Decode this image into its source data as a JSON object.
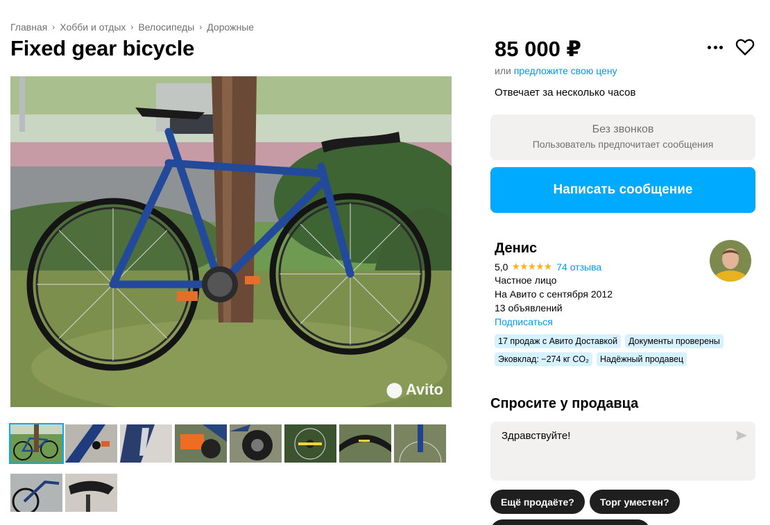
{
  "breadcrumbs": [
    "Главная",
    "Хобби и отдых",
    "Велосипеды",
    "Дорожные"
  ],
  "listing": {
    "title": "Fixed gear bicycle",
    "price": "85 000 ₽",
    "offer_prefix": "или",
    "offer_link": "предложите свою цену",
    "response_time": "Отвечает за несколько часов"
  },
  "contact": {
    "no_calls_title": "Без звонков",
    "no_calls_subtitle": "Пользователь предпочитает сообщения",
    "write_button": "Написать сообщение"
  },
  "seller": {
    "name": "Денис",
    "rating": "5,0",
    "stars": "★★★★★",
    "reviews": "74 отзыва",
    "type": "Частное лицо",
    "since": "На Авито с сентября 2012",
    "listings": "13 объявлений",
    "subscribe": "Подписаться",
    "badges": [
      "17 продаж с Авито Доставкой",
      "Документы проверены",
      "Эковклад: −274 кг CO₂",
      "Надёжный продавец"
    ]
  },
  "photo": {
    "watermark": "Avito",
    "thumbnail_count": 10,
    "active_thumbnail": 1
  },
  "ask": {
    "title": "Спросите у продавца",
    "message": "Здравствуйте!",
    "quick_replies": [
      "Ещё продаёте?",
      "Торг уместен?"
    ]
  },
  "colors": {
    "accent": "#00aaff",
    "link": "#0099f7",
    "star": "#ffb021",
    "badge_bg": "#d6f1ff",
    "panel_bg": "#f2f1f0",
    "chip_bg": "#1f1f1f"
  },
  "icons": {
    "more": "more-horizontal-icon",
    "favorite": "heart-outline-icon",
    "send": "send-arrow-icon",
    "breadcrumb_separator": "chevron-right-icon"
  }
}
